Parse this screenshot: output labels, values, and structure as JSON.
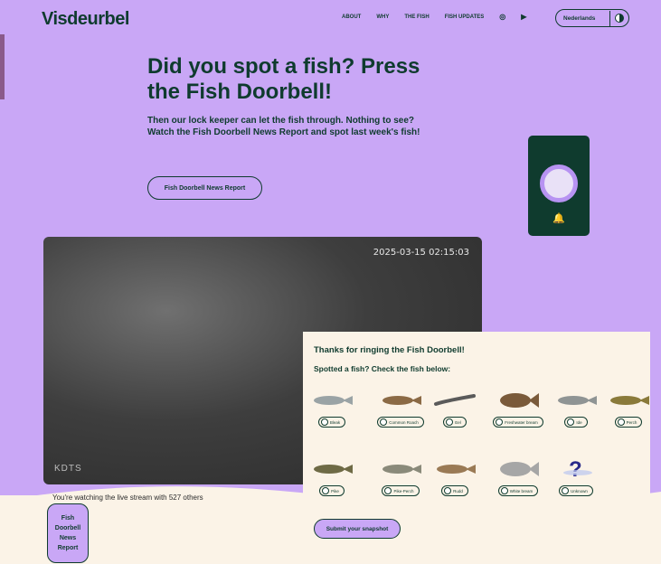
{
  "header": {
    "logo": "Visdeurbel",
    "nav": [
      "ABOUT",
      "WHY",
      "THE FISH",
      "FISH UPDATES"
    ],
    "language": "Nederlands"
  },
  "hero": {
    "title": "Did you spot a fish? Press the Fish Doorbell!",
    "subtitle": "Then our lock keeper can let the fish through. Nothing to see? Watch the Fish Doorbell News Report and spot last week's fish!",
    "button": "Fish Doorbell News Report"
  },
  "video": {
    "timestamp": "2025-03-15 02:15:03",
    "camera": "KDTS"
  },
  "stream": {
    "viewers_text": "You're watching the live stream with 527 others",
    "news_button": "Fish Doorbell News Report"
  },
  "panel": {
    "title": "Thanks for ringing the Fish Doorbell!",
    "subtitle": "Spotted a fish? Check the fish below:",
    "fish": [
      {
        "label": "Bleak",
        "color": "#9aa3a5"
      },
      {
        "label": "Common Roach",
        "color": "#8b6a45"
      },
      {
        "label": "Eel",
        "color": "#5a5a5a"
      },
      {
        "label": "Freshwater bream",
        "color": "#7a5a3a"
      },
      {
        "label": "Ide",
        "color": "#8f9494"
      },
      {
        "label": "Perch",
        "color": "#8a7a3a"
      },
      {
        "label": "Pike",
        "color": "#6e6a45"
      },
      {
        "label": "Pike-Perch",
        "color": "#8a8a7a"
      },
      {
        "label": "Rudd",
        "color": "#9a7a55"
      },
      {
        "label": "White bream",
        "color": "#a6a6a6"
      },
      {
        "label": "Unknown",
        "color": "#2a2a8a"
      }
    ],
    "submit": "Submit your snapshot"
  }
}
